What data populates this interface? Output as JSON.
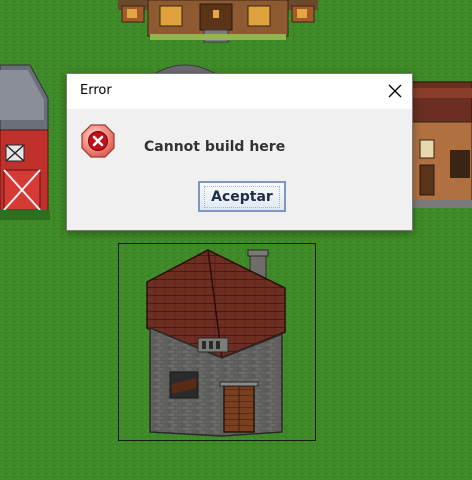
{
  "dialog": {
    "title": "Error",
    "message": "Cannot build here",
    "ok_label": "Aceptar",
    "close_glyph": "×",
    "icon": "error-x-icon"
  },
  "scene": {
    "terrain": "grass",
    "selected_building": "stone-house",
    "selection_state": "invalid-placement"
  },
  "colors": {
    "grass": "#3f8a28",
    "selection_outline": "#1a1a1a",
    "error_icon": "#e83a3a"
  }
}
